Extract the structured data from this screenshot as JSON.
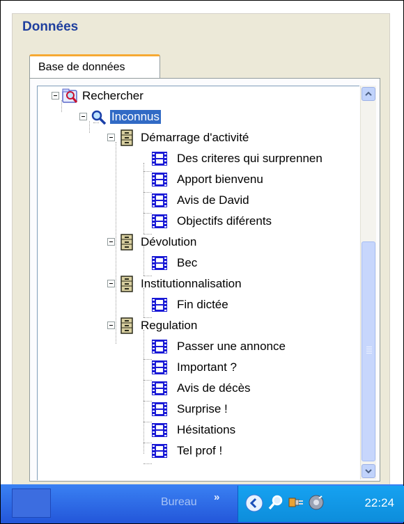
{
  "window": {
    "title": "Données"
  },
  "tabs": [
    {
      "label": "Base de données"
    }
  ],
  "tree": {
    "root": "Rechercher",
    "selected": "Inconnus",
    "groups": [
      {
        "label": "Démarrage d'activité",
        "items": [
          "Des criteres qui surprennen",
          "Apport bienvenu",
          "Avis de David",
          "Objectifs diférents"
        ]
      },
      {
        "label": "Dévolution",
        "items": [
          "Bec"
        ]
      },
      {
        "label": "Institutionnalisation",
        "items": [
          "Fin dictée"
        ]
      },
      {
        "label": "Regulation",
        "items": [
          "Passer une annonce",
          "Important ?",
          "Avis de décès",
          "Surprise !",
          "Hésitations",
          "Tel prof !"
        ]
      }
    ]
  },
  "taskbar": {
    "bureau": "Bureau",
    "chevron": "»",
    "clock": "22:24"
  },
  "icons": {
    "search-folder": "magnifier-folder-icon",
    "search": "magnifier-icon",
    "group": "filing-cabinet-icon",
    "item": "film-icon"
  },
  "colors": {
    "title": "#1F3F9E",
    "selection": "#316AC5",
    "taskbar": "#2F6BEA",
    "tray": "#12A0EE"
  }
}
